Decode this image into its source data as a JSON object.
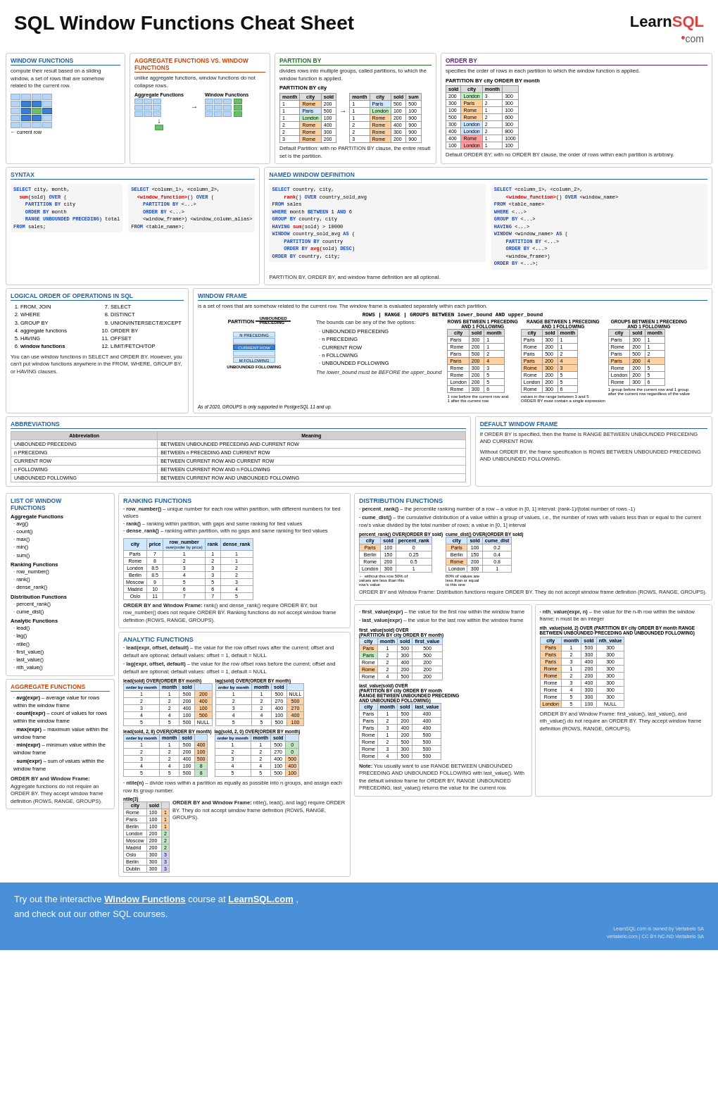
{
  "header": {
    "title": "SQL Window Functions Cheat Sheet",
    "logo_learn": "Learn",
    "logo_sql": "SQL",
    "logo_dot": "•",
    "logo_com": ".com"
  },
  "sections": {
    "window_functions": {
      "title": "WINDOW FUNCTIONS",
      "desc": "compute their result based on a sliding window, a set of rows that are somehow related to the current row.",
      "label_current_row": "current row"
    },
    "agg_vs_wf": {
      "title": "AGGREGATE FUNCTIONS VS. WINDOW FUNCTIONS",
      "desc": "unlike aggregate functions, window functions do not collapse rows.",
      "label_agg": "Aggregate Functions",
      "label_wf": "Window Functions"
    },
    "partition_by": {
      "title": "PARTITION BY",
      "desc": "divides rows into multiple groups, called partitions, to which the window function is applied.",
      "label": "PARTITION BY city",
      "default_text": "Default Partition: with no PARTITION BY clause, the entire result set is the partition."
    },
    "order_by": {
      "title": "ORDER BY",
      "desc": "specifies the order of rows in each partition to which the window function is applied.",
      "label": "PARTITION BY city ORDER BY month",
      "default_text": "Default ORDER BY: with no ORDER BY clause, the order of rows within each partition is arbitrary."
    },
    "syntax": {
      "title": "SYNTAX",
      "code1": "SELECT city, month,\n  sum(sold) OVER (\n    PARTITION BY city\n    ORDER BY month\n    RANGE UNBOUNDED PRECEDING) total\nFROM sales;",
      "code2": "SELECT <column_1>, <column_2>,\n  <window_function>() OVER (\n    PARTITION BY <...>\n    ORDER BY <...>\n    <window_frame>) <window_column_alias>\nFROM <table_name>;"
    },
    "named_window": {
      "title": "Named Window Definition",
      "code1": "SELECT country, city,\n    rank() OVER country_sold_avg\nFROM sales\nWHERE month BETWEEN 1 AND 6\nGROUP BY country, city\nHAVING sum(sold) > 10000\nWINDOW country_sold_avg AS (\n    PARTITION BY country\n    ORDER BY avg(sold) DESC)\nORDER BY country, city;",
      "code2": "SELECT <column_1>, <column_2>,\n    <window_function>() OVER <window_name>\nFROM <table_name>\nWHERE <...>\nGROUP BY <...>\nHAVING <...>\nWINDOW <window_name> AS (\n    PARTITION BY <...>\n    ORDER BY <...>\n    <window_frame>)\nORDER BY <...>;",
      "note": "PARTITION BY, ORDER BY, and window frame definition are all optional."
    },
    "logical_order": {
      "title": "LOGICAL ORDER OF OPERATIONS IN SQL",
      "items_left": [
        "1.  FROM, JOIN",
        "2.  WHERE",
        "3.  GROUP BY",
        "4.  aggregate functions",
        "5.  HAVING",
        "6.  window functions"
      ],
      "items_right": [
        "7.  SELECT",
        "8.  DISTINCT",
        "9.  UNION/INTERSECT/EXCEPT",
        "10. ORDER BY",
        "11. OFFSET",
        "12. LIMIT/FETCH/TOP"
      ],
      "note": "You can use window functions in SELECT and ORDER BY. However, you can't put window functions anywhere in the FROM, WHERE, GROUP BY, or HAVING clauses."
    },
    "window_frame": {
      "title": "WINDOW FRAME",
      "desc": "is a set of rows that are somehow related to the current row. The window frame is evaluated separately within each partition.",
      "syntax": "ROWS | RANGE | GROUPS BETWEEN lower_bound AND upper_bound",
      "labels": [
        "PARTITION",
        "UNBOUNDED PRECEDING",
        "N PRECEDING",
        "CURRENT ROW",
        "M FOLLOWING",
        "UNBOUNDED FOLLOWING"
      ],
      "bounds": [
        "UNBOUNDED PRECEDING",
        "n PRECEDING",
        "CURRENT ROW",
        "n FOLLOWING",
        "UNBOUNDED FOLLOWING"
      ],
      "lower_note": "The lower_bound must be BEFORE the upper_bound",
      "groups_note": "As of 2020, GROUPS is only supported in PostgreSQL 11 and up."
    },
    "abbreviations": {
      "title": "ABBREVIATIONS",
      "headers": [
        "Abbreviation",
        "Meaning"
      ],
      "rows": [
        [
          "UNBOUNDED PRECEDING",
          "BETWEEN UNBOUNDED PRECEDING AND CURRENT ROW"
        ],
        [
          "n PRECEDING",
          "BETWEEN n PRECEDING AND CURRENT ROW"
        ],
        [
          "CURRENT ROW",
          "BETWEEN CURRENT ROW AND CURRENT ROW"
        ],
        [
          "n FOLLOWING",
          "BETWEEN CURRENT ROW AND n FOLLOWING"
        ],
        [
          "UNBOUNDED FOLLOWING",
          "BETWEEN CURRENT ROW AND UNBOUNDED FOLLOWING"
        ]
      ]
    },
    "default_window_frame": {
      "title": "DEFAULT WINDOW FRAME",
      "text1": "If ORDER BY is specified, then the frame is RANGE BETWEEN UNBOUNDED PRECEDING AND CURRENT ROW.",
      "text2": "Without ORDER BY, the frame specification is ROWS BETWEEN UNBOUNDED PRECEDING AND UNBOUNDED FOLLOWING."
    },
    "list_window_functions": {
      "title": "LIST OF WINDOW FUNCTIONS",
      "agg_title": "Aggregate Functions",
      "agg_items": [
        "avg()",
        "count()",
        "max()",
        "min()",
        "sum()"
      ],
      "ranking_title": "Ranking Functions",
      "ranking_items": [
        "row_number()",
        "rank()",
        "dense_rank()"
      ],
      "dist_title": "Distribution Functions",
      "dist_items": [
        "percent_rank()",
        "cume_dist()"
      ],
      "analytic_title": "Analytic Functions",
      "analytic_items": [
        "lead()",
        "lag()",
        "ntile()",
        "first_value()",
        "last_value()",
        "nth_value()"
      ],
      "agg2_title": "AGGREGATE FUNCTIONS",
      "agg2_items": [
        "avg(expr) – average value for rows within the window frame",
        "count(expr) – count of values for rows within the window frame",
        "max(expr) – maximum value within the window frame",
        "min(expr) – minimum value within the window frame",
        "sum(expr) – sum of values within the window frame"
      ],
      "order_note": "ORDER BY and Window Frame: Aggregate functions do not require an ORDER BY. They accept window frame definition (ROWS, RANGE, GROUPS)."
    },
    "ranking_functions": {
      "title": "RANKING FUNCTIONS",
      "row_number": "row_number() – unique number for each row within partition, with different numbers for tied values",
      "rank": "rank() – ranking within partition, with gaps and same ranking for tied values",
      "dense_rank": "dense_rank() – ranking within partition, with no gaps and same ranking for tied values",
      "table_headers": [
        "city",
        "price",
        "row_number",
        "rank",
        "dense_rank"
      ],
      "table_rows": [
        [
          "Paris",
          "7",
          "1",
          "1",
          "1"
        ],
        [
          "Rome",
          "8",
          "2",
          "2",
          "1"
        ],
        [
          "London",
          "8.5",
          "3",
          "3",
          "2"
        ],
        [
          "Berlin",
          "8.5",
          "4",
          "3",
          "2"
        ],
        [
          "Moscow",
          "9",
          "5",
          "5",
          "3"
        ],
        [
          "Madrid",
          "10",
          "6",
          "6",
          "4"
        ],
        [
          "Oslo",
          "11",
          "7",
          "7",
          "5"
        ]
      ],
      "note": "ORDER BY and Window Frame: rank() and dense_rank() require ORDER BY, but row_number() does not require ORDER BY. Ranking functions do not accept window frame definition (ROWS, RANGE, GROUPS)."
    },
    "distribution_functions": {
      "title": "DISTRIBUTION FUNCTIONS",
      "percent_rank": "percent_rank() – the percentile ranking number of a row – a value in [0, 1] interval: (rank-1)/(total number of rows -1)",
      "cume_dist": "cume_dist() – the cumulative distribution of a value within a group of values, i.e., the number of rows with values less than or equal to the current row's value divided by the total number of rows; a value in [0, 1] interval",
      "note": "ORDER BY and Window Frame: Distribution functions require ORDER BY. They do not accept window frame definition (ROWS, RANGE, GROUPS)."
    },
    "analytic_functions": {
      "title": "ANALYTIC FUNCTIONS",
      "lead": "lead(expr, offset, default) – the value for the row offset rows after the current; offset and default are optional; default values: offset = 1, default = NULL",
      "lag": "lag(expr, offset, default) – the value for the row offset rows before the current; offset and default are optional; default values: offset = 1, default = NULL",
      "ntile": "ntile(n) – divide rows within a partition as equally as possible into n groups, and assign each row its group number.",
      "first_value": "first_value(expr) – the value for the first row within the window frame",
      "last_value": "last_value(expr) – the value for the last row within the window frame",
      "nth_value": "nth_value(expr, n) – the value for the n-th row within the window frame; n must be an integer",
      "note_lead_lag": "ORDER BY and Window Frame: ntile(), lead(), and lag() require ORDER BY. They do not accept window frame definition (ROWS, RANGE, GROUPS).",
      "note_first_last": "ORDER BY and Window Frame: first_value(), last_value(), and nth_value() do not require an ORDER BY. They accept window frame definition (ROWS, RANGE, GROUPS)."
    },
    "bottom_banner": {
      "text_before": "Try out the interactive ",
      "link1": "Window Functions",
      "text_middle": " course at ",
      "link2": "LearnSQL.com",
      "text_after": ",",
      "line2": "and check out our other SQL courses.",
      "copyright": "LearnSQL.com is owned by Vertabelo SA",
      "license": "vertabelo.com | CC BY-NC-ND Vertabelo SA"
    }
  }
}
